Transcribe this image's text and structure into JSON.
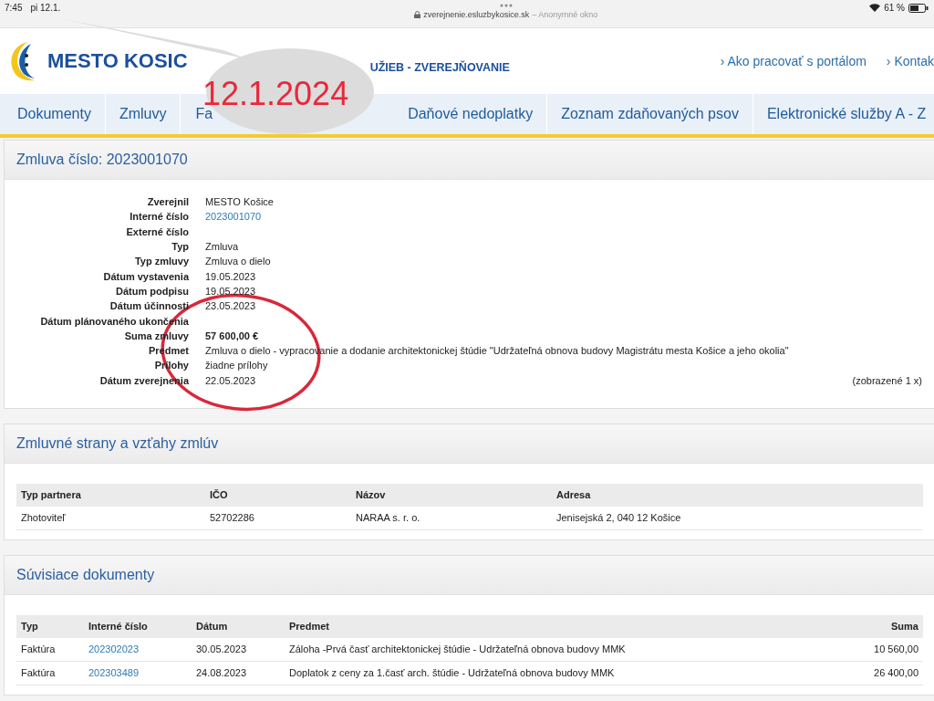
{
  "status_bar": {
    "time": "7:45",
    "date": "pi 12.1.",
    "url": "zverejnenie.esluzbykosice.sk",
    "url_note": "– Anonymné okno",
    "battery": "61 %"
  },
  "header": {
    "title": "MESTO KOSIC",
    "subtitle": "UŽIEB - ZVEREJŇOVANIE",
    "links": [
      "› Ako pracovať s portálom",
      "› Kontak"
    ]
  },
  "nav": {
    "items": [
      {
        "label": "Dokumenty"
      },
      {
        "label": "Zmluvy"
      },
      {
        "label": "Fa"
      },
      {
        "label": "Daňové nedoplatky"
      },
      {
        "label": "Zoznam zdaňovaných psov"
      },
      {
        "label": "Elektronické služby A - Z"
      }
    ]
  },
  "annotation": {
    "bubble_text": "12.1.2024"
  },
  "contract": {
    "title_prefix": "Zmluva číslo:",
    "title_number": "2023001070",
    "fields": [
      {
        "label": "Zverejnil",
        "value": "MESTO Košice",
        "kind": "text"
      },
      {
        "label": "Interné číslo",
        "value": "2023001070",
        "kind": "link"
      },
      {
        "label": "Externé číslo"
      },
      {
        "label": "Typ",
        "value": "Zmluva",
        "kind": "text"
      },
      {
        "label": "Typ zmluvy",
        "value": "Zmluva o dielo",
        "kind": "text"
      },
      {
        "label": "Dátum vystavenia",
        "value": "19.05.2023",
        "kind": "text"
      },
      {
        "label": "Dátum podpisu",
        "value": "19.05.2023",
        "kind": "text"
      },
      {
        "label": "Dátum účinnosti",
        "value": "23.05.2023",
        "kind": "text"
      },
      {
        "label": "Dátum plánovaného ukončenia"
      },
      {
        "label": "Suma zmluvy",
        "value": "57 600,00 €",
        "kind": "bold"
      },
      {
        "label": "Predmet",
        "value": "Zmluva o dielo - vypracovanie a dodanie architektonickej štúdie \"Udržateľná obnova budovy Magistrátu mesta Košice a jeho okolia\"",
        "kind": "text"
      },
      {
        "label": "Prílohy",
        "value": "žiadne prílohy",
        "kind": "text"
      },
      {
        "label": "Dátum zverejnenia",
        "value": "22.05.2023",
        "kind": "text",
        "note": "(zobrazené 1 x)"
      }
    ]
  },
  "parties": {
    "title": "Zmluvné strany a vzťahy zmlúv",
    "columns": [
      "Typ partnera",
      "IČO",
      "Názov",
      "Adresa"
    ],
    "rows": [
      [
        "Zhotoviteľ",
        "52702286",
        "NARAA s. r. o.",
        "Jenisejská 2, 040 12 Košice"
      ]
    ]
  },
  "documents": {
    "title": "Súvisiace dokumenty",
    "columns": [
      "Typ",
      "Interné číslo",
      "Dátum",
      "Predmet",
      "Suma"
    ],
    "rows": [
      [
        "Faktúra",
        "202302023",
        "30.05.2023",
        "Záloha -Prvá časť architektonickej štúdie - Udržateľná obnova budovy MMK",
        "10 560,00"
      ],
      [
        "Faktúra",
        "202303489",
        "24.08.2023",
        "Doplatok z ceny za 1.časť arch. štúdie - Udržateľná obnova budovy MMK",
        "26 400,00"
      ]
    ]
  }
}
